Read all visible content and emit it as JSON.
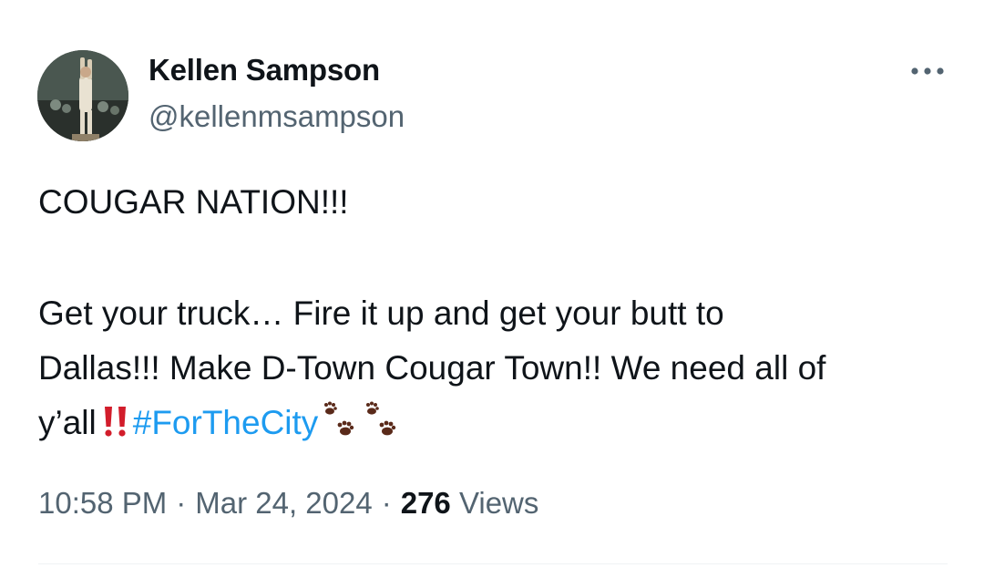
{
  "author": {
    "display_name": "Kellen Sampson",
    "handle": "@kellenmsampson"
  },
  "more_icon": "more-horizontal-icon",
  "tweet": {
    "line1": "COUGAR NATION!!!",
    "line2": "Get your truck… Fire it up and get your butt to",
    "line3": "Dallas!!! Make D-Town Cougar Town!! We need all of",
    "line4_prefix": "y’all",
    "hashtag": "#ForTheCity",
    "emojis": [
      "double-exclamation-icon",
      "paw-prints-icon",
      "paw-prints-icon"
    ]
  },
  "meta": {
    "time": "10:58 PM",
    "separator": "·",
    "date": "Mar 24, 2024",
    "views_count": "276",
    "views_label": "Views"
  },
  "colors": {
    "text": "#0f1419",
    "secondary": "#536471",
    "link": "#1d9bf0",
    "exclamation": "#d21d2b",
    "paw": "#5a2a1a"
  }
}
